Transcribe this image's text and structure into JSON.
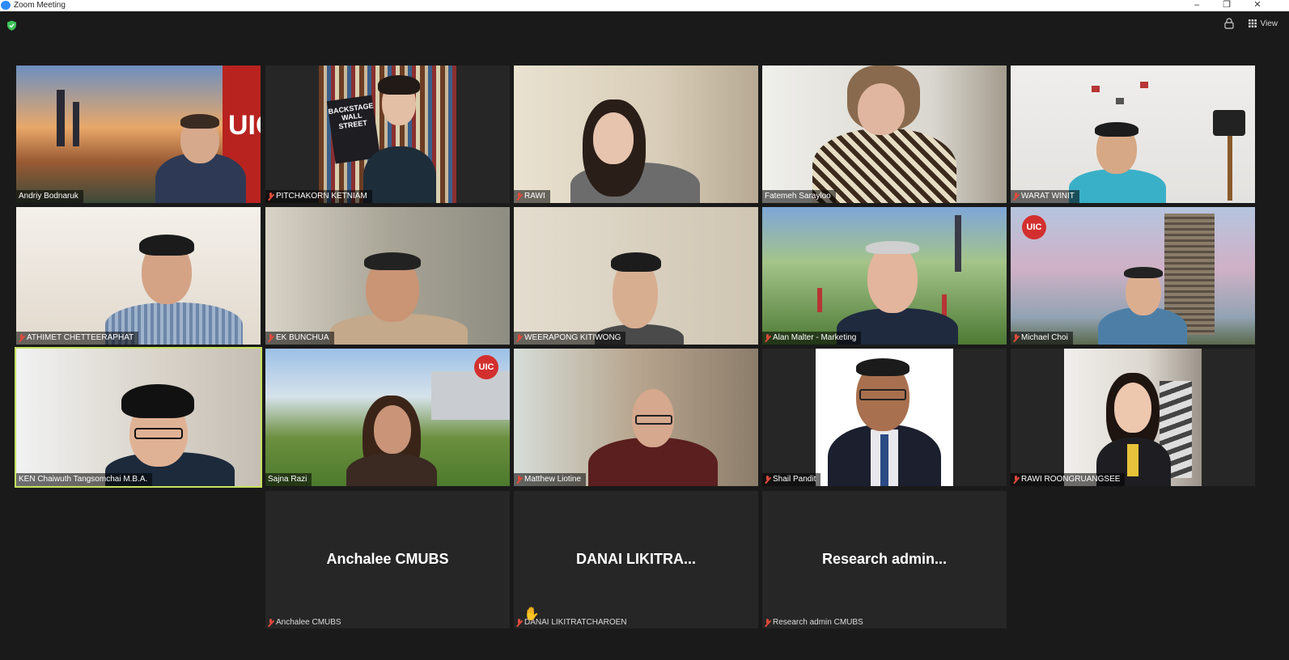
{
  "window": {
    "title": "Zoom Meeting",
    "minimize": "–",
    "restore": "❐",
    "close": "✕"
  },
  "toolbar": {
    "view_label": "View"
  },
  "participants": [
    "Andriy Bodnaruk",
    "PITCHAKORN KETNIAM",
    "RAWI",
    "Fatemeh Sarayloo",
    "WARAT WINIT",
    "ATHIMET CHETTEERAPHAT",
    "EK BUNCHUA",
    "WEERAPONG KITIWONG",
    "Alan Malter - Marketing",
    "Michael Choi",
    "KEN Chaiwuth Tangsomchai M.B.A.",
    "Sajna Razi",
    "Matthew Liotine",
    "Shail Pandit",
    "RAWI ROONGRUANGSEE"
  ],
  "book_title": "BACKSTAGE WALL STREET",
  "uic_logo": "UIC",
  "name_only": [
    {
      "display": "Anchalee CMUBS",
      "label": "Anchalee CMUBS"
    },
    {
      "display": "DANAI  LIKITRA...",
      "label": "DANAI LIKITRATCHAROEN"
    },
    {
      "display": "Research  admin...",
      "label": "Research admin CMUBS"
    }
  ],
  "colors": {
    "accent_border": "#c6e15d",
    "muted_mic": "#e04a3a",
    "shield": "#3cc25a",
    "background": "#1a1a1a"
  }
}
